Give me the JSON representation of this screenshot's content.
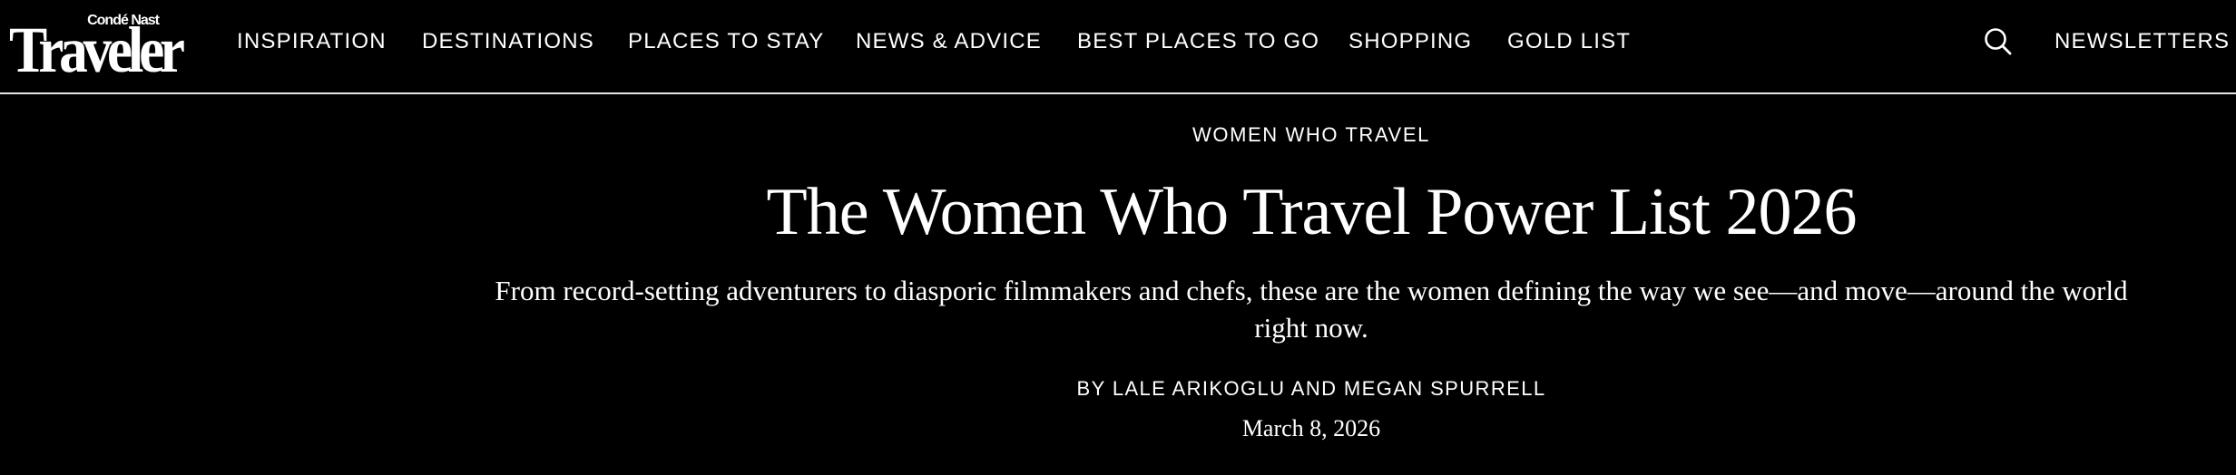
{
  "brand": {
    "logo_small": "Condé Nast",
    "logo_main": "Traveler"
  },
  "nav": {
    "items": [
      {
        "label": "INSPIRATION"
      },
      {
        "label": "DESTINATIONS"
      },
      {
        "label": "PLACES TO STAY"
      },
      {
        "label": "NEWS & ADVICE"
      },
      {
        "label": "BEST PLACES TO GO"
      },
      {
        "label": "SHOPPING"
      },
      {
        "label": "GOLD LIST"
      }
    ],
    "search_icon": "search-icon",
    "newsletters_label": "NEWSLETTERS"
  },
  "article": {
    "rubric": "WOMEN WHO TRAVEL",
    "headline": "The Women Who Travel Power List 2026",
    "dek": "From record-setting adventurers to diasporic filmmakers and chefs, these are the women defining the way we see—and move—around the world right now.",
    "byline_prefix": "BY",
    "author_1": "LALE ARIKOGLU",
    "byline_joiner": "AND",
    "author_2": "MEGAN SPURRELL",
    "date": "March 8, 2026"
  },
  "colors": {
    "background": "#000000",
    "text": "#ffffff",
    "divider": "#e6e6e6"
  }
}
